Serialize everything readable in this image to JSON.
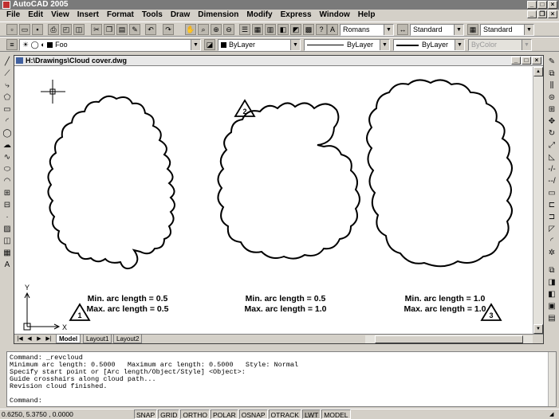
{
  "window": {
    "title": "AutoCAD 2005"
  },
  "menu": [
    "File",
    "Edit",
    "View",
    "Insert",
    "Format",
    "Tools",
    "Draw",
    "Dimension",
    "Modify",
    "Express",
    "Window",
    "Help"
  ],
  "toolbar2": {
    "layer": "Foo",
    "color": "ByLayer",
    "linetype": "ByLayer",
    "lineweight": "ByLayer",
    "plotstyle": "ByColor"
  },
  "styles": {
    "text_style": "Romans",
    "dim_style": "Standard",
    "table_style": "Standard"
  },
  "drawing": {
    "title": "H:\\Drawings\\Cloud cover.dwg"
  },
  "tabs": [
    "Model",
    "Layout1",
    "Layout2"
  ],
  "ucs": {
    "x": "X",
    "y": "Y"
  },
  "clouds": [
    {
      "number": "1",
      "min_label": "Min. arc length = 0.5",
      "max_label": "Max. arc length = 0.5"
    },
    {
      "number": "2",
      "min_label": "Min. arc length = 0.5",
      "max_label": "Max. arc length = 1.0"
    },
    {
      "number": "3",
      "min_label": "Min. arc length = 1.0",
      "max_label": "Max. arc length = 1.0"
    }
  ],
  "command": {
    "history": [
      "Command: _revcloud",
      "Minimum arc length: 0.5000   Maximum arc length: 0.5000   Style: Normal",
      "Specify start point or [Arc length/Object/Style] <Object>:",
      "Guide crosshairs along cloud path...",
      "Revision cloud finished."
    ],
    "prompt": "Command:"
  },
  "status": {
    "coords": "0.6250, 5.3750 , 0.0000",
    "toggles": [
      {
        "label": "SNAP",
        "on": false
      },
      {
        "label": "GRID",
        "on": false
      },
      {
        "label": "ORTHO",
        "on": false
      },
      {
        "label": "POLAR",
        "on": false
      },
      {
        "label": "OSNAP",
        "on": false
      },
      {
        "label": "OTRACK",
        "on": false
      },
      {
        "label": "LWT",
        "on": true
      },
      {
        "label": "MODEL",
        "on": false
      }
    ]
  }
}
